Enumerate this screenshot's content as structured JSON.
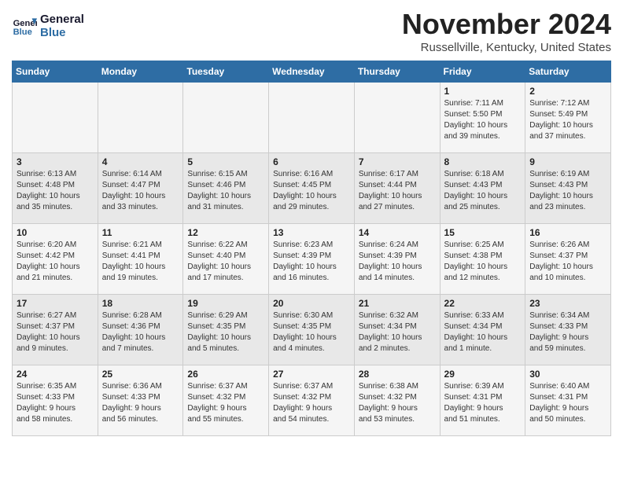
{
  "header": {
    "logo_line1": "General",
    "logo_line2": "Blue",
    "month": "November 2024",
    "location": "Russellville, Kentucky, United States"
  },
  "weekdays": [
    "Sunday",
    "Monday",
    "Tuesday",
    "Wednesday",
    "Thursday",
    "Friday",
    "Saturday"
  ],
  "weeks": [
    [
      {
        "day": "",
        "info": ""
      },
      {
        "day": "",
        "info": ""
      },
      {
        "day": "",
        "info": ""
      },
      {
        "day": "",
        "info": ""
      },
      {
        "day": "",
        "info": ""
      },
      {
        "day": "1",
        "info": "Sunrise: 7:11 AM\nSunset: 5:50 PM\nDaylight: 10 hours\nand 39 minutes."
      },
      {
        "day": "2",
        "info": "Sunrise: 7:12 AM\nSunset: 5:49 PM\nDaylight: 10 hours\nand 37 minutes."
      }
    ],
    [
      {
        "day": "3",
        "info": "Sunrise: 6:13 AM\nSunset: 4:48 PM\nDaylight: 10 hours\nand 35 minutes."
      },
      {
        "day": "4",
        "info": "Sunrise: 6:14 AM\nSunset: 4:47 PM\nDaylight: 10 hours\nand 33 minutes."
      },
      {
        "day": "5",
        "info": "Sunrise: 6:15 AM\nSunset: 4:46 PM\nDaylight: 10 hours\nand 31 minutes."
      },
      {
        "day": "6",
        "info": "Sunrise: 6:16 AM\nSunset: 4:45 PM\nDaylight: 10 hours\nand 29 minutes."
      },
      {
        "day": "7",
        "info": "Sunrise: 6:17 AM\nSunset: 4:44 PM\nDaylight: 10 hours\nand 27 minutes."
      },
      {
        "day": "8",
        "info": "Sunrise: 6:18 AM\nSunset: 4:43 PM\nDaylight: 10 hours\nand 25 minutes."
      },
      {
        "day": "9",
        "info": "Sunrise: 6:19 AM\nSunset: 4:43 PM\nDaylight: 10 hours\nand 23 minutes."
      }
    ],
    [
      {
        "day": "10",
        "info": "Sunrise: 6:20 AM\nSunset: 4:42 PM\nDaylight: 10 hours\nand 21 minutes."
      },
      {
        "day": "11",
        "info": "Sunrise: 6:21 AM\nSunset: 4:41 PM\nDaylight: 10 hours\nand 19 minutes."
      },
      {
        "day": "12",
        "info": "Sunrise: 6:22 AM\nSunset: 4:40 PM\nDaylight: 10 hours\nand 17 minutes."
      },
      {
        "day": "13",
        "info": "Sunrise: 6:23 AM\nSunset: 4:39 PM\nDaylight: 10 hours\nand 16 minutes."
      },
      {
        "day": "14",
        "info": "Sunrise: 6:24 AM\nSunset: 4:39 PM\nDaylight: 10 hours\nand 14 minutes."
      },
      {
        "day": "15",
        "info": "Sunrise: 6:25 AM\nSunset: 4:38 PM\nDaylight: 10 hours\nand 12 minutes."
      },
      {
        "day": "16",
        "info": "Sunrise: 6:26 AM\nSunset: 4:37 PM\nDaylight: 10 hours\nand 10 minutes."
      }
    ],
    [
      {
        "day": "17",
        "info": "Sunrise: 6:27 AM\nSunset: 4:37 PM\nDaylight: 10 hours\nand 9 minutes."
      },
      {
        "day": "18",
        "info": "Sunrise: 6:28 AM\nSunset: 4:36 PM\nDaylight: 10 hours\nand 7 minutes."
      },
      {
        "day": "19",
        "info": "Sunrise: 6:29 AM\nSunset: 4:35 PM\nDaylight: 10 hours\nand 5 minutes."
      },
      {
        "day": "20",
        "info": "Sunrise: 6:30 AM\nSunset: 4:35 PM\nDaylight: 10 hours\nand 4 minutes."
      },
      {
        "day": "21",
        "info": "Sunrise: 6:32 AM\nSunset: 4:34 PM\nDaylight: 10 hours\nand 2 minutes."
      },
      {
        "day": "22",
        "info": "Sunrise: 6:33 AM\nSunset: 4:34 PM\nDaylight: 10 hours\nand 1 minute."
      },
      {
        "day": "23",
        "info": "Sunrise: 6:34 AM\nSunset: 4:33 PM\nDaylight: 9 hours\nand 59 minutes."
      }
    ],
    [
      {
        "day": "24",
        "info": "Sunrise: 6:35 AM\nSunset: 4:33 PM\nDaylight: 9 hours\nand 58 minutes."
      },
      {
        "day": "25",
        "info": "Sunrise: 6:36 AM\nSunset: 4:33 PM\nDaylight: 9 hours\nand 56 minutes."
      },
      {
        "day": "26",
        "info": "Sunrise: 6:37 AM\nSunset: 4:32 PM\nDaylight: 9 hours\nand 55 minutes."
      },
      {
        "day": "27",
        "info": "Sunrise: 6:37 AM\nSunset: 4:32 PM\nDaylight: 9 hours\nand 54 minutes."
      },
      {
        "day": "28",
        "info": "Sunrise: 6:38 AM\nSunset: 4:32 PM\nDaylight: 9 hours\nand 53 minutes."
      },
      {
        "day": "29",
        "info": "Sunrise: 6:39 AM\nSunset: 4:31 PM\nDaylight: 9 hours\nand 51 minutes."
      },
      {
        "day": "30",
        "info": "Sunrise: 6:40 AM\nSunset: 4:31 PM\nDaylight: 9 hours\nand 50 minutes."
      }
    ]
  ]
}
